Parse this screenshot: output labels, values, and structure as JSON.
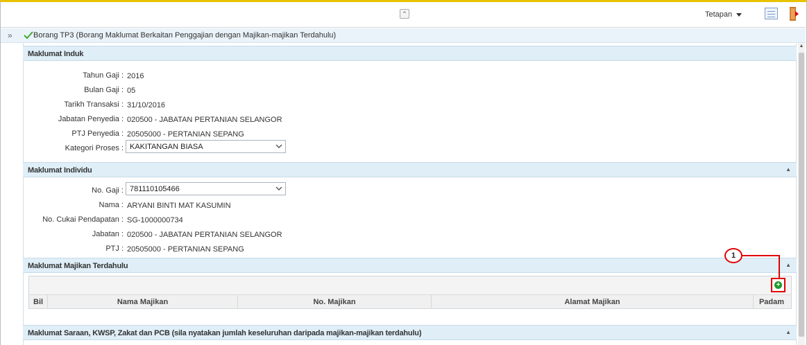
{
  "topbar": {
    "collapse_glyph": "⌃",
    "tetapan_label": "Tetapan",
    "icons": [
      "chevron-up-icon",
      "caret-down-icon",
      "list-view-icon",
      "exit-icon"
    ]
  },
  "form": {
    "expand_glyph": "»",
    "title": "Borang TP3 (Borang Maklumat Berkaitan Penggajian dengan Majikan-majikan Terdahulu)"
  },
  "sections": {
    "induk": {
      "title": "Maklumat Induk"
    },
    "individu": {
      "title": "Maklumat Individu",
      "arrow": "▲"
    },
    "majikan": {
      "title": "Maklumat Majikan Terdahulu",
      "arrow": "▲"
    },
    "saraan": {
      "title": "Maklumat Saraan, KWSP, Zakat dan PCB (sila nyatakan jumlah keseluruhan daripada majikan-majikan terdahulu)",
      "arrow": "▲"
    }
  },
  "induk": {
    "tahun_gaji": {
      "label": "Tahun Gaji :",
      "value": "2016"
    },
    "bulan_gaji": {
      "label": "Bulan Gaji :",
      "value": "05"
    },
    "tarikh_transaksi": {
      "label": "Tarikh Transaksi :",
      "value": "31/10/2016"
    },
    "jabatan_penyedia": {
      "label": "Jabatan Penyedia :",
      "value": "020500 - JABATAN PERTANIAN SELANGOR"
    },
    "ptj_penyedia": {
      "label": "PTJ Penyedia :",
      "value": "20505000 - PERTANIAN SEPANG"
    },
    "kategori_proses": {
      "label": "Kategori Proses :",
      "value": "KAKITANGAN BIASA"
    }
  },
  "individu": {
    "no_gaji": {
      "label": "No. Gaji :",
      "value": "781110105466"
    },
    "nama": {
      "label": "Nama :",
      "value": "ARYANI BINTI MAT KASUMIN"
    },
    "no_cukai": {
      "label": "No. Cukai Pendapatan :",
      "value": "SG-1000000734"
    },
    "jabatan": {
      "label": "Jabatan :",
      "value": "020500 - JABATAN PERTANIAN SELANGOR"
    },
    "ptj": {
      "label": "PTJ :",
      "value": "20505000 - PERTANIAN SEPANG"
    }
  },
  "table": {
    "columns": [
      "Bil",
      "Nama Majikan",
      "No. Majikan",
      "Alamat Majikan",
      "Padam"
    ],
    "add_glyph": "+"
  },
  "callout": {
    "number": "1"
  },
  "colors": {
    "accent_red": "#e00000",
    "header_blue": "#dfeef7",
    "add_green": "#1e9a2e"
  }
}
